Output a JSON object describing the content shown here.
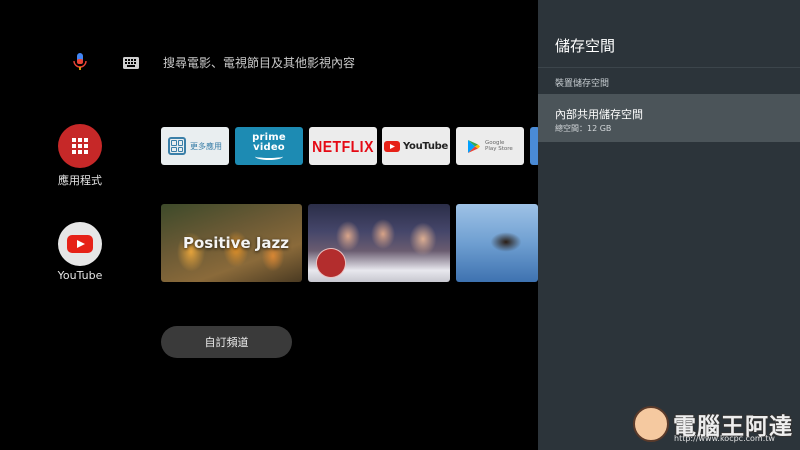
{
  "search": {
    "placeholder": "搜尋電影、電視節目及其他影視內容"
  },
  "rail": {
    "apps_label": "應用程式",
    "youtube_label": "YouTube"
  },
  "apps_row": {
    "more_apps_label": "更多應用",
    "prime_label": "prime video",
    "netflix_label": "NETFLIX",
    "youtube_label": "YouTube",
    "google_play_label": "Google Play Store"
  },
  "content_row": {
    "jazz_card_title": "Positive Jazz"
  },
  "custom_channels_label": "自訂頻道",
  "storage_panel": {
    "title": "儲存空間",
    "section_label": "裝置儲存空間",
    "internal_storage": {
      "title": "內部共用儲存空間",
      "total": "總空間：12 GB"
    }
  },
  "watermark": {
    "text": "電腦王阿達",
    "url": "http://www.kocpc.com.tw"
  },
  "colors": {
    "panel_bg": "#2c343a",
    "highlight_bg": "#4b5459",
    "apps_button": "#c62828",
    "netflix_red": "#e50914",
    "prime_blue": "#1d8bb3"
  },
  "icons": [
    "microphone-icon",
    "keyboard-icon",
    "apps-grid-icon",
    "youtube-play-icon",
    "google-play-icon"
  ]
}
